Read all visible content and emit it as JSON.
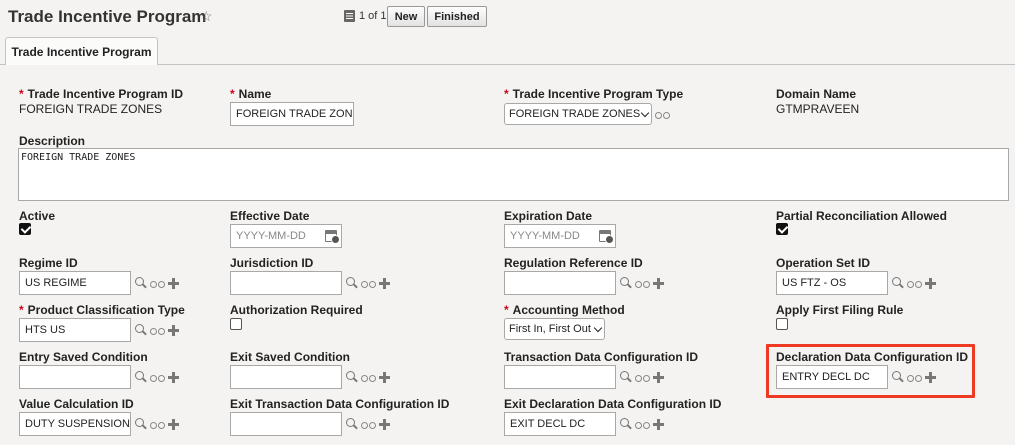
{
  "header": {
    "title": "Trade Incentive Program",
    "pager_text": "1 of 1",
    "new_label": "New",
    "finished_label": "Finished"
  },
  "tab": {
    "label": "Trade Incentive Program"
  },
  "fields": {
    "program_id": {
      "label": "Trade Incentive Program ID",
      "value": "FOREIGN TRADE ZONES"
    },
    "name": {
      "label": "Name",
      "value": "FOREIGN TRADE ZON"
    },
    "program_type": {
      "label": "Trade Incentive Program Type",
      "value": "FOREIGN TRADE ZONES"
    },
    "domain_name": {
      "label": "Domain Name",
      "value": "GTMPRAVEEN"
    },
    "description": {
      "label": "Description",
      "value": "FOREIGN TRADE ZONES"
    },
    "active": {
      "label": "Active",
      "checked": true
    },
    "effective_date": {
      "label": "Effective Date",
      "placeholder": "YYYY-MM-DD"
    },
    "expiration_date": {
      "label": "Expiration Date",
      "placeholder": "YYYY-MM-DD"
    },
    "partial_reconciliation": {
      "label": "Partial Reconciliation Allowed",
      "checked": true
    },
    "regime_id": {
      "label": "Regime ID",
      "value": "US REGIME"
    },
    "jurisdiction_id": {
      "label": "Jurisdiction ID",
      "value": ""
    },
    "regulation_reference_id": {
      "label": "Regulation Reference ID",
      "value": ""
    },
    "operation_set_id": {
      "label": "Operation Set ID",
      "value": "US FTZ - OS"
    },
    "product_classification_type": {
      "label": "Product Classification Type",
      "value": "HTS US"
    },
    "authorization_required": {
      "label": "Authorization Required",
      "checked": false
    },
    "accounting_method": {
      "label": "Accounting Method",
      "value": "First In, First Out"
    },
    "apply_first_filing_rule": {
      "label": "Apply First Filing Rule",
      "checked": false
    },
    "entry_saved_condition": {
      "label": "Entry Saved Condition",
      "value": ""
    },
    "exit_saved_condition": {
      "label": "Exit Saved Condition",
      "value": ""
    },
    "transaction_data_config_id": {
      "label": "Transaction Data Configuration ID",
      "value": ""
    },
    "declaration_data_config_id": {
      "label": "Declaration Data Configuration ID",
      "value": "ENTRY DECL DC"
    },
    "value_calculation_id": {
      "label": "Value Calculation ID",
      "value": "DUTY SUSPENSION"
    },
    "exit_transaction_data_config_id": {
      "label": "Exit Transaction Data Configuration ID",
      "value": ""
    },
    "exit_declaration_data_config_id": {
      "label": "Exit Declaration Data Configuration ID",
      "value": "EXIT DECL DC"
    }
  },
  "colors": {
    "highlight": "#ee3a22",
    "required": "#d0021b"
  }
}
